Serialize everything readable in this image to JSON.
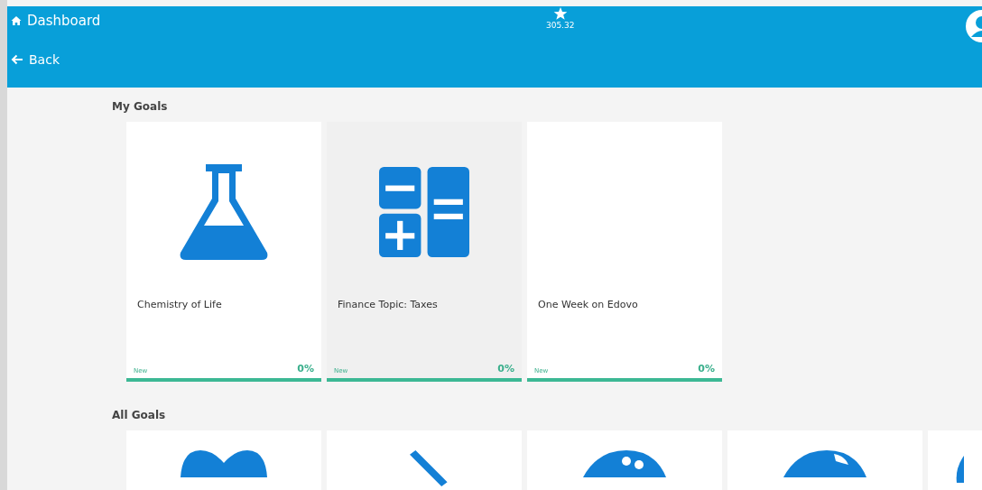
{
  "header": {
    "home_label": "Dashboard",
    "points": "305.32",
    "back_label": "Back"
  },
  "my_goals": {
    "title": "My Goals",
    "cards": [
      {
        "title": "Chemistry of Life",
        "kind": "flask",
        "status": "New",
        "percent": "0%",
        "selected": false
      },
      {
        "title": "Finance Topic: Taxes",
        "kind": "calculator",
        "status": "New",
        "percent": "0%",
        "selected": true
      },
      {
        "title": "One Week on Edovo",
        "kind": "blank",
        "status": "New",
        "percent": "0%",
        "selected": false
      }
    ]
  },
  "all_goals": {
    "title": "All Goals",
    "cards": [
      {
        "kind": "heart"
      },
      {
        "kind": "pencil"
      },
      {
        "kind": "palette"
      },
      {
        "kind": "globe"
      },
      {
        "kind": "partial"
      }
    ]
  }
}
